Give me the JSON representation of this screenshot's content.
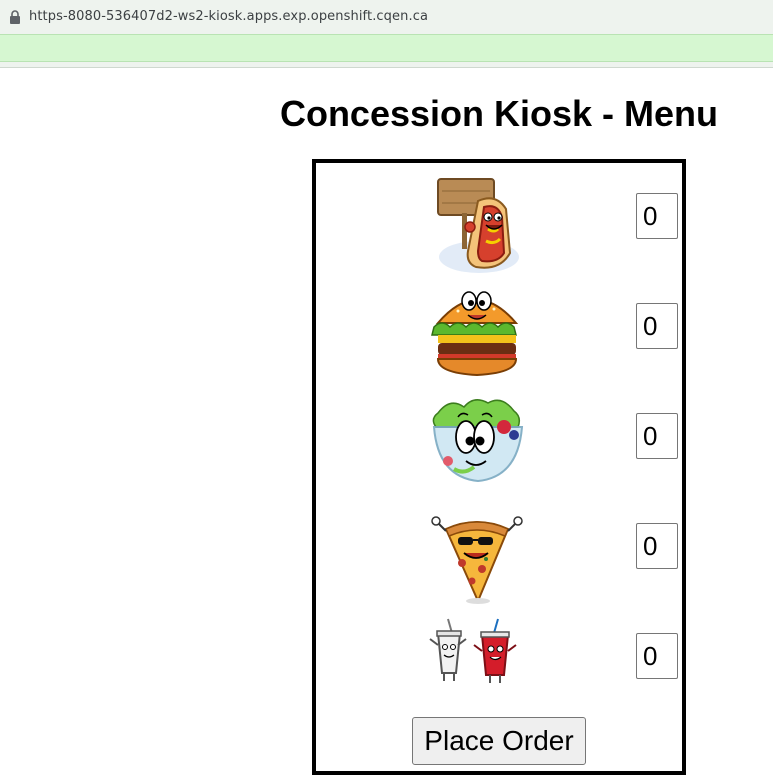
{
  "browser": {
    "url": "https-8080-536407d2-ws2-kiosk.apps.exp.openshift.cqen.ca"
  },
  "page": {
    "title": "Concession Kiosk - Menu"
  },
  "menu": {
    "items": [
      {
        "icon": "hotdog-icon",
        "quantity": "0"
      },
      {
        "icon": "hamburger-icon",
        "quantity": "0"
      },
      {
        "icon": "salad-icon",
        "quantity": "0"
      },
      {
        "icon": "pizza-icon",
        "quantity": "0"
      },
      {
        "icon": "soda-icon",
        "quantity": "0"
      }
    ],
    "place_order_label": "Place Order"
  },
  "colors": {
    "progress": "#d6f7d1",
    "border": "#000000",
    "button_bg": "#efefef"
  }
}
